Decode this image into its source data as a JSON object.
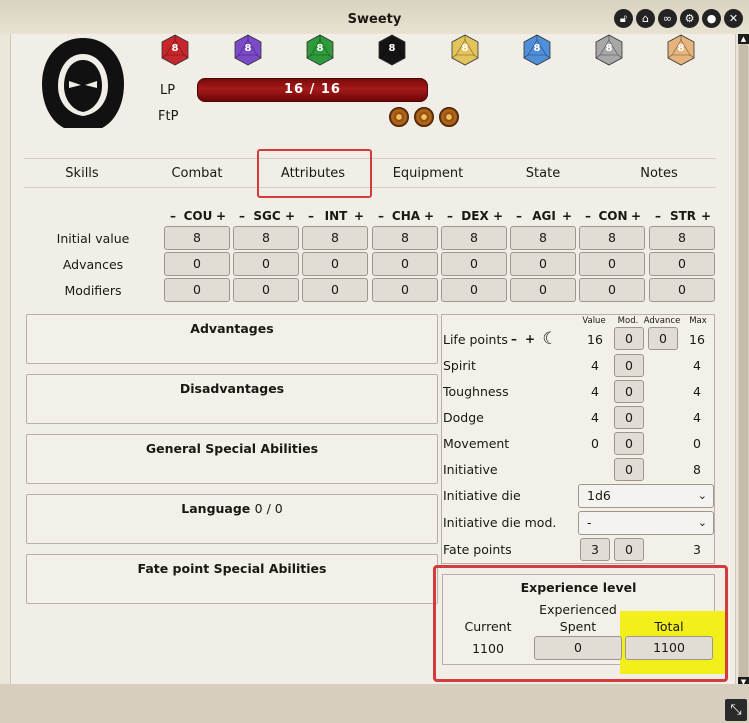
{
  "window": {
    "title": "Sweety"
  },
  "header_icons": [
    "lock-icon",
    "bank-icon",
    "link-icon",
    "gear-icon",
    "user-icon",
    "close-icon"
  ],
  "dice": [
    {
      "value": "8",
      "color": "#c8262d"
    },
    {
      "value": "8",
      "color": "#7b4ac9"
    },
    {
      "value": "8",
      "color": "#2e9a3c"
    },
    {
      "value": "8",
      "color": "#141414"
    },
    {
      "value": "8",
      "color": "#e3c45a"
    },
    {
      "value": "8",
      "color": "#4f8fd9"
    },
    {
      "value": "8",
      "color": "#a7a7a7"
    },
    {
      "value": "8",
      "color": "#e6b47d"
    }
  ],
  "stats": {
    "lp_label": "LP",
    "lp_value": "16  /  16",
    "ftp_label": "FtP"
  },
  "tabs": [
    "Skills",
    "Combat",
    "Attributes",
    "Equipment",
    "State",
    "Notes"
  ],
  "attributes": {
    "headers": [
      "COU",
      "SGC",
      "INT",
      "CHA",
      "DEX",
      "AGI",
      "CON",
      "STR"
    ],
    "minus": "–",
    "plus": "+",
    "rows": [
      {
        "label": "Initial value",
        "values": [
          "8",
          "8",
          "8",
          "8",
          "8",
          "8",
          "8",
          "8"
        ]
      },
      {
        "label": "Advances",
        "values": [
          "0",
          "0",
          "0",
          "0",
          "0",
          "0",
          "0",
          "0"
        ]
      },
      {
        "label": "Modifiers",
        "values": [
          "0",
          "0",
          "0",
          "0",
          "0",
          "0",
          "0",
          "0"
        ]
      }
    ]
  },
  "panels": {
    "advantages": "Advantages",
    "disadvantages": "Disadvantages",
    "general_sa": "General Special Abilities",
    "language": "Language",
    "language_count": "0 / 0",
    "fate_sa": "Fate point Special Abilities"
  },
  "derived": {
    "headers": {
      "value": "Value",
      "mod": "Mod.",
      "advance": "Advance",
      "max": "Max"
    },
    "life_points": {
      "label": "Life points",
      "minus": "–",
      "plus": "+",
      "value": "16",
      "mod": "0",
      "advance": "0",
      "max": "16"
    },
    "spirit": {
      "label": "Spirit",
      "value": "4",
      "mod": "0",
      "max": "4"
    },
    "toughness": {
      "label": "Toughness",
      "value": "4",
      "mod": "0",
      "max": "4"
    },
    "dodge": {
      "label": "Dodge",
      "value": "4",
      "mod": "0",
      "max": "4"
    },
    "movement": {
      "label": "Movement",
      "value": "0",
      "mod": "0",
      "max": "0"
    },
    "initiative": {
      "label": "Initiative",
      "mod": "0",
      "max": "8"
    },
    "initiative_die": {
      "label": "Initiative die",
      "selected": "1d6"
    },
    "initiative_die_mod": {
      "label": "Initiative die mod.",
      "selected": "-"
    },
    "fate_points": {
      "label": "Fate points",
      "value": "3",
      "mod": "0",
      "max": "3"
    }
  },
  "experience": {
    "title": "Experience level",
    "current_label": "Current",
    "spent_label_1": "Experienced",
    "spent_label_2": "Spent",
    "total_label": "Total",
    "current": "1100",
    "spent": "0",
    "total": "1100"
  }
}
